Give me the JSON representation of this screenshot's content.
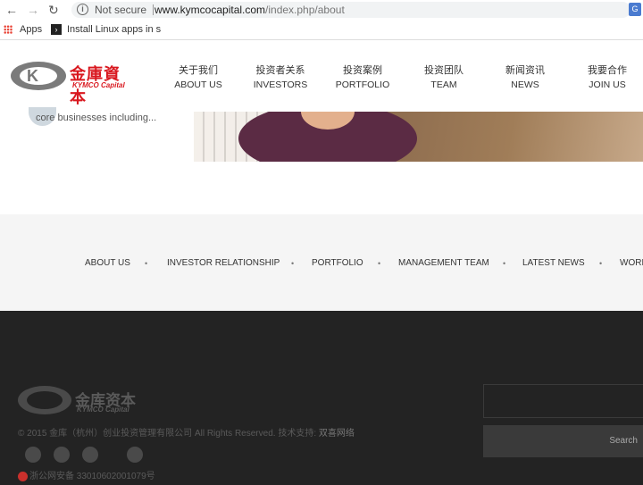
{
  "browser": {
    "security_label": "Not secure",
    "url_host": "www.kymcocapital.com",
    "url_path": "/index.php/about",
    "bookmarks": [
      {
        "label": "Apps"
      },
      {
        "label": "Install Linux apps in s"
      }
    ]
  },
  "header": {
    "logo_cn": "金庫資本",
    "logo_en": "KYMCO Capital",
    "nav": [
      {
        "cn": "关于我们",
        "en": "ABOUT US"
      },
      {
        "cn": "投资者关系",
        "en": "INVESTORS"
      },
      {
        "cn": "投资案例",
        "en": "PORTFOLIO"
      },
      {
        "cn": "投资团队",
        "en": "TEAM"
      },
      {
        "cn": "新闻资讯",
        "en": "NEWS"
      },
      {
        "cn": "我要合作",
        "en": "JOIN US"
      }
    ]
  },
  "content": {
    "snippet": "core businesses including..."
  },
  "footer_links": [
    "ABOUT US",
    "INVESTOR RELATIONSHIP",
    "PORTFOLIO",
    "MANAGEMENT TEAM",
    "LATEST NEWS",
    "WORK"
  ],
  "footer": {
    "logo_cn": "金库资本",
    "logo_en": "KYMCO Capital",
    "copyright": "© 2015 金库（杭州）创业投资管理有限公司 All Rights Reserved. 技术支持:",
    "support": "双喜网络",
    "icp": "浙公网安备 33010602001079号",
    "search_button": "Search"
  },
  "colors": {
    "brand_red": "#d9181f",
    "footer_bg": "#232323"
  }
}
